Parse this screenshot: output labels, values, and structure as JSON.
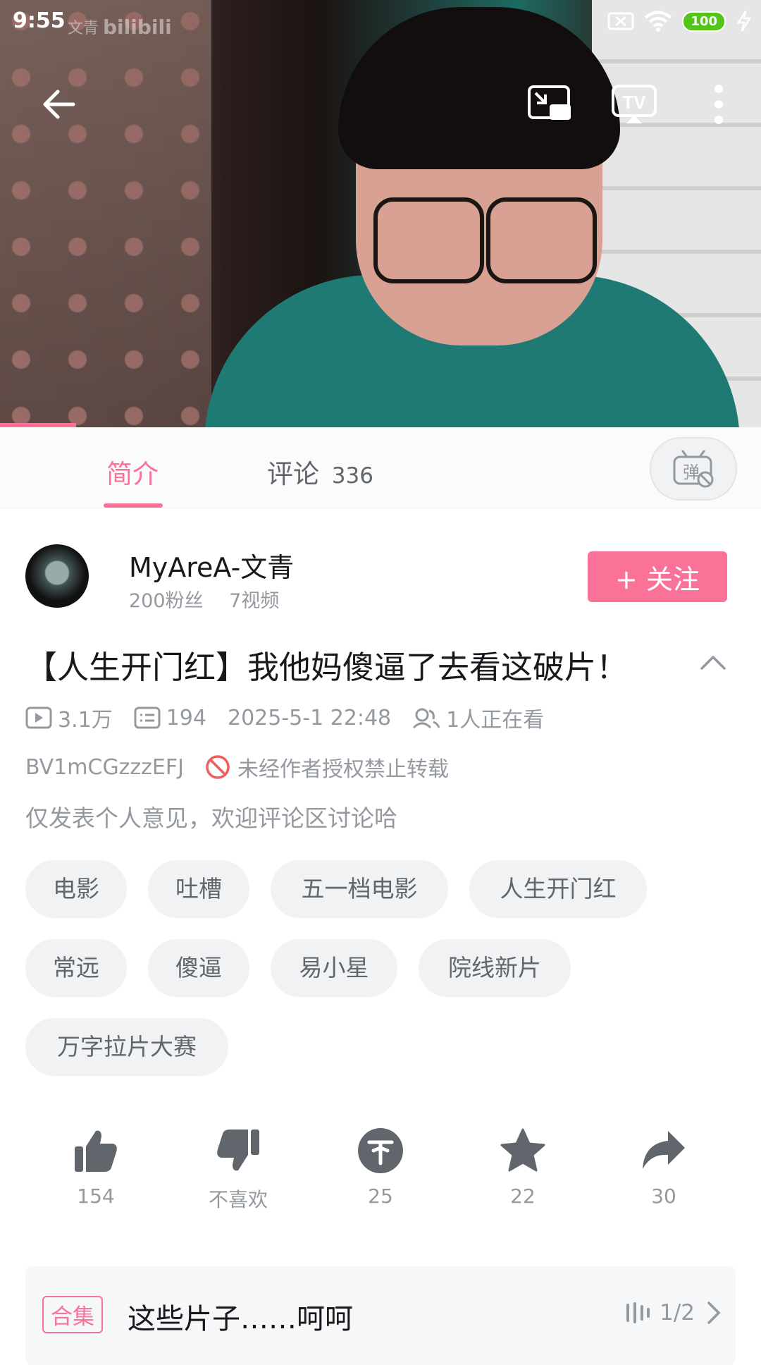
{
  "status_bar": {
    "time": "9:55",
    "battery": "100"
  },
  "watermark": {
    "line1": "文青",
    "brand": "bilibili"
  },
  "tabs": [
    {
      "label": "简介"
    },
    {
      "label": "评论",
      "count": "336"
    }
  ],
  "uploader": {
    "name": "MyAreA-文青",
    "fans": "200粉丝",
    "videos": "7视频",
    "follow_label": "+ 关注"
  },
  "video": {
    "title": "【人生开门红】我他妈傻逼了去看这破片！",
    "views": "3.1万",
    "danmaku": "194",
    "date": "2025-5-1 22:48",
    "watching": "1人正在看",
    "bvid": "BV1mCGzzzEFJ",
    "copyright": "未经作者授权禁止转载",
    "description": "仅发表个人意见，欢迎评论区讨论哈",
    "progress_fraction": 0.1
  },
  "tags": [
    "电影",
    "吐槽",
    "五一档电影",
    "人生开门红",
    "常远",
    "傻逼",
    "易小星",
    "院线新片",
    "万字拉片大赛"
  ],
  "actions": {
    "like": "154",
    "dislike": "不喜欢",
    "coin": "25",
    "favorite": "22",
    "share": "30"
  },
  "collection": {
    "badge": "合集",
    "title": "这些片子……呵呵",
    "progress": "1/2"
  },
  "icons": {
    "back": "back-arrow-icon",
    "pip": "picture-in-picture-icon",
    "tv": "tv-cast-icon",
    "more": "more-vertical-icon",
    "danmaku_toggle": "danmaku-off-icon"
  },
  "colors": {
    "accent": "#fb7299",
    "text": "#18191c",
    "secondary": "#9499a0",
    "tag_bg": "#f1f2f3"
  }
}
